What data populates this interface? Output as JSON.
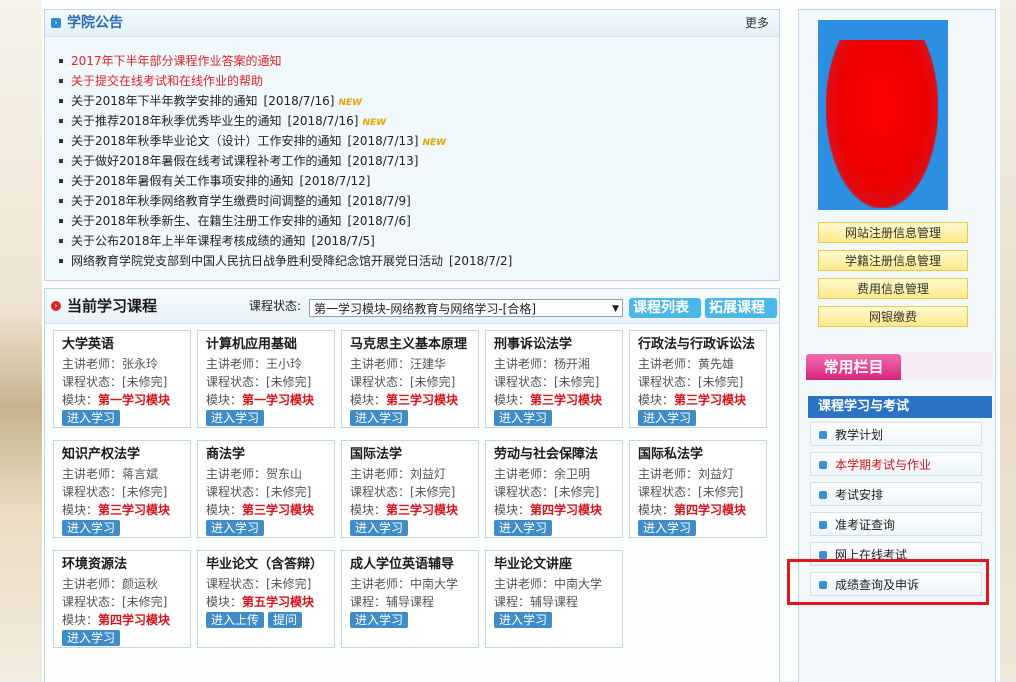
{
  "notice": {
    "title": "学院公告",
    "more": "更多",
    "items": [
      {
        "text": "2017年下半年部分课程作业答案的通知",
        "date": "",
        "new": false,
        "red": true
      },
      {
        "text": "关于提交在线考试和在线作业的帮助",
        "date": "",
        "new": false,
        "red": true
      },
      {
        "text": "关于2018年下半年教学安排的通知",
        "date": "[2018/7/16]",
        "new": true,
        "red": false
      },
      {
        "text": "关于推荐2018年秋季优秀毕业生的通知",
        "date": "[2018/7/16]",
        "new": true,
        "red": false
      },
      {
        "text": "关于2018年秋季毕业论文（设计）工作安排的通知",
        "date": "[2018/7/13]",
        "new": true,
        "red": false
      },
      {
        "text": "关于做好2018年暑假在线考试课程补考工作的通知",
        "date": "[2018/7/13]",
        "new": false,
        "red": false
      },
      {
        "text": "关于2018年暑假有关工作事项安排的通知",
        "date": "[2018/7/12]",
        "new": false,
        "red": false
      },
      {
        "text": "关于2018年秋季网络教育学生缴费时间调整的通知",
        "date": "[2018/7/9]",
        "new": false,
        "red": false
      },
      {
        "text": "关于2018年秋季新生、在籍生注册工作安排的通知",
        "date": "[2018/7/6]",
        "new": false,
        "red": false
      },
      {
        "text": "关于公布2018年上半年课程考核成绩的通知",
        "date": "[2018/7/5]",
        "new": false,
        "red": false
      },
      {
        "text": "网络教育学院党支部到中国人民抗日战争胜利受降纪念馆开展党日活动",
        "date": "[2018/7/2]",
        "new": false,
        "red": false
      }
    ],
    "new_label": "NEW"
  },
  "courses": {
    "title": "当前学习课程",
    "status_label": "课程状态:",
    "status_value": "第一学习模块-网络教育与网络学习-[合格]",
    "list_btn": "课程列表",
    "ext_btn": "拓展课程",
    "items": [
      {
        "name": "大学英语",
        "l1": "主讲老师：张永玲",
        "l2": "课程状态：[未修完]",
        "mod_prefix": "模块：",
        "mod": "第一学习模块",
        "buttons": [
          "进入学习"
        ]
      },
      {
        "name": "计算机应用基础",
        "l1": "主讲老师：王小玲",
        "l2": "课程状态：[未修完]",
        "mod_prefix": "模块：",
        "mod": "第一学习模块",
        "buttons": [
          "进入学习"
        ]
      },
      {
        "name": "马克思主义基本原理",
        "l1": "主讲老师：汪建华",
        "l2": "课程状态：[未修完]",
        "mod_prefix": "模块：",
        "mod": "第三学习模块",
        "buttons": [
          "进入学习"
        ]
      },
      {
        "name": "刑事诉讼法学",
        "l1": "主讲老师：杨开湘",
        "l2": "课程状态：[未修完]",
        "mod_prefix": "模块：",
        "mod": "第三学习模块",
        "buttons": [
          "进入学习"
        ]
      },
      {
        "name": "行政法与行政诉讼法",
        "l1": "主讲老师：黄先雄",
        "l2": "课程状态：[未修完]",
        "mod_prefix": "模块：",
        "mod": "第三学习模块",
        "buttons": [
          "进入学习"
        ]
      },
      {
        "name": "知识产权法学",
        "l1": "主讲老师：蒋言斌",
        "l2": "课程状态：[未修完]",
        "mod_prefix": "模块：",
        "mod": "第三学习模块",
        "buttons": [
          "进入学习"
        ]
      },
      {
        "name": "商法学",
        "l1": "主讲老师：贺东山",
        "l2": "课程状态：[未修完]",
        "mod_prefix": "模块：",
        "mod": "第三学习模块",
        "buttons": [
          "进入学习"
        ]
      },
      {
        "name": "国际法学",
        "l1": "主讲老师：刘益灯",
        "l2": "课程状态：[未修完]",
        "mod_prefix": "模块：",
        "mod": "第三学习模块",
        "buttons": [
          "进入学习"
        ]
      },
      {
        "name": "劳动与社会保障法",
        "l1": "主讲老师：余卫明",
        "l2": "课程状态：[未修完]",
        "mod_prefix": "模块：",
        "mod": "第四学习模块",
        "buttons": [
          "进入学习"
        ]
      },
      {
        "name": "国际私法学",
        "l1": "主讲老师：刘益灯",
        "l2": "课程状态：[未修完]",
        "mod_prefix": "模块：",
        "mod": "第四学习模块",
        "buttons": [
          "进入学习"
        ]
      },
      {
        "name": "环境资源法",
        "l1": "主讲老师：颜运秋",
        "l2": "课程状态：[未修完]",
        "mod_prefix": "模块：",
        "mod": "第四学习模块",
        "buttons": [
          "进入学习"
        ]
      },
      {
        "name": "毕业论文（含答辩）",
        "l1": "课程状态：[未修完]",
        "l2": "",
        "mod_prefix": "模块：",
        "mod": "第五学习模块",
        "buttons": [
          "进入上传",
          "提问"
        ]
      },
      {
        "name": "成人学位英语辅导",
        "l1": "主讲老师：中南大学",
        "l2": "",
        "mod_prefix": "课程：",
        "mod": "辅导课程",
        "plain_mod": true,
        "buttons": [
          "进入学习"
        ]
      },
      {
        "name": "毕业论文讲座",
        "l1": "主讲老师：中南大学",
        "l2": "",
        "mod_prefix": "课程：",
        "mod": "辅导课程",
        "plain_mod": true,
        "buttons": [
          "进入学习"
        ]
      }
    ]
  },
  "sidebar": {
    "buttons": [
      "网站注册信息管理",
      "学籍注册信息管理",
      "费用信息管理",
      "网银缴费"
    ],
    "common_tab": "常用栏目",
    "section": "课程学习与考试",
    "menu": [
      {
        "label": "教学计划",
        "active": false
      },
      {
        "label": "本学期考试与作业",
        "active": true
      },
      {
        "label": "考试安排",
        "active": false
      },
      {
        "label": "准考证查询",
        "active": false
      },
      {
        "label": "网上在线考试",
        "active": false
      },
      {
        "label": "成绩查询及申诉",
        "active": false
      }
    ]
  },
  "colors": {
    "accent": "#2a72c4",
    "highlight": "#e8141c",
    "module_red": "#d8141c"
  }
}
